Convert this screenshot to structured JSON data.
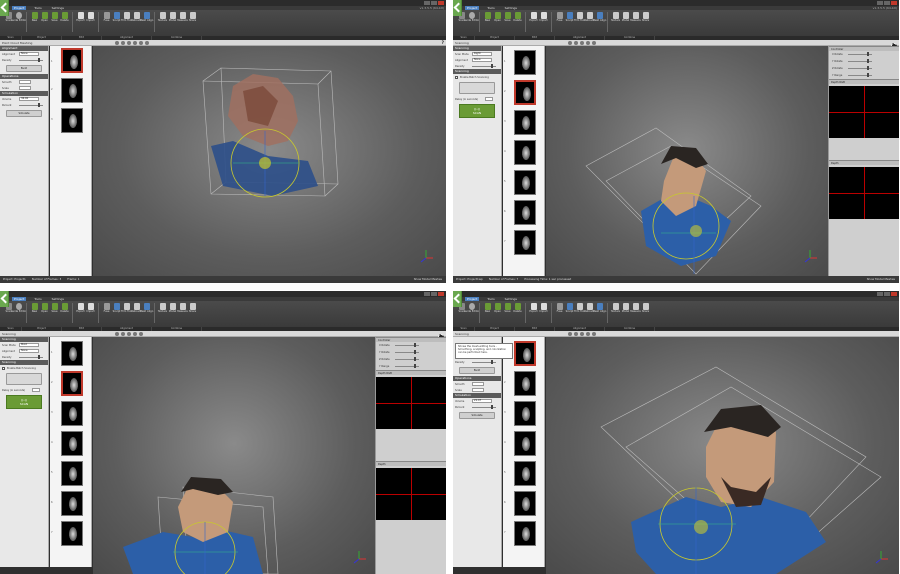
{
  "app": {
    "menus": [
      "Project",
      "Tools",
      "Settings"
    ],
    "version": "v1.3.5.5 (64-bit)",
    "ribbon_buttons": [
      "Scan",
      "Guide Editor",
      "New",
      "Open",
      "Save",
      "Delete",
      "Export",
      "Import",
      "Fuse",
      "Sculpt",
      "Trim Tool",
      "Retouch",
      "Mesh Align",
      "Texture",
      "Model",
      "Measure",
      "Share"
    ],
    "groups": [
      "Scan",
      "Project",
      "Edit",
      "Alignment",
      "Combine"
    ],
    "help": "?"
  },
  "q1": {
    "toolrow_title": "Point Cloud Meshing",
    "panel": {
      "section1": "Alignment",
      "alignment_label": "Alignment",
      "alignment_value": "None",
      "density_label": "Density",
      "build_label": "Build",
      "section2": "Operations",
      "smooth_label": "Smooth",
      "scale_label": "Scale",
      "section3": "Simulation",
      "volume_label": "Volume",
      "volume_value": "36.00",
      "percent_label": "Percent",
      "sim_button": "Simulate"
    },
    "thumb_numbers": [
      "1",
      "2",
      "3"
    ],
    "status": {
      "project": "Project: Project1",
      "frames": "Number of Frames: 3",
      "frame": "Frame: 1",
      "right": "Show Model Meshes"
    }
  },
  "q2": {
    "toolrow_title": "Scanning",
    "panel": {
      "section1": "Scanning",
      "scan_mode_label": "Scan Mode",
      "scan_mode_value": "Right",
      "alignment_label": "Alignment",
      "alignment_value": "None",
      "density_label": "Density",
      "section2": "Scanning",
      "checkbox_label": "Enable Batch Scanning",
      "delay_label": "Delay (in seconds)",
      "scan_button": "SCAN"
    },
    "thumb_numbers": [
      "1",
      "2",
      "3",
      "4",
      "5",
      "6",
      "7"
    ],
    "right_panel": {
      "title": "Controller",
      "rows": [
        "X Rotate",
        "Y Rotate",
        "Z Rotate",
        "Y Range"
      ],
      "depth_rgb": "Depth RGB",
      "depth": "Depth"
    },
    "status": {
      "project": "Project: Project1wp",
      "frames": "Number of Frames: 7",
      "processing": "Processing Time: 1 sec processed",
      "right": "Show Model Meshes"
    }
  },
  "q3": {
    "toolrow_title": "Scanning",
    "panel": {
      "section1": "Scanning",
      "scan_mode_label": "Scan Mode",
      "scan_mode_value": "Mold",
      "alignment_label": "Alignment",
      "alignment_value": "None",
      "density_label": "Density",
      "section2": "Scanning",
      "checkbox_label": "Enable Batch Scanning",
      "delay_label": "Delay (in seconds)",
      "scan_button": "SCAN"
    },
    "thumb_numbers": [
      "1",
      "2",
      "3",
      "4",
      "5",
      "6",
      "7"
    ],
    "right_panel": {
      "title": "Controller",
      "rows": [
        "X Rotate",
        "Y Rotate",
        "Z Rotate",
        "Y Range"
      ],
      "depth_rgb": "Depth RGB",
      "depth": "Depth"
    }
  },
  "q4": {
    "toolrow_title": "Scanning",
    "tooltip": "Shows the mesh-editing tools - Smoothing, sculpting, and colorization can be performed here.",
    "panel": {
      "density_label": "Density",
      "build_label": "Build",
      "section2": "Operations",
      "smooth_label": "Smooth",
      "scale_label": "Scale",
      "section3": "Simulation",
      "volume_label": "Volume",
      "volume_value": "21.07",
      "percent_label": "Percent",
      "sim_button": "Simulate"
    },
    "thumb_numbers": [
      "1",
      "2",
      "3",
      "4",
      "5",
      "6",
      "7"
    ]
  },
  "colors": {
    "accent_green": "#6a9b35",
    "selection_red": "#c0392b",
    "shirt_blue": "#2c5fa8",
    "skin": "#c49a7a"
  }
}
